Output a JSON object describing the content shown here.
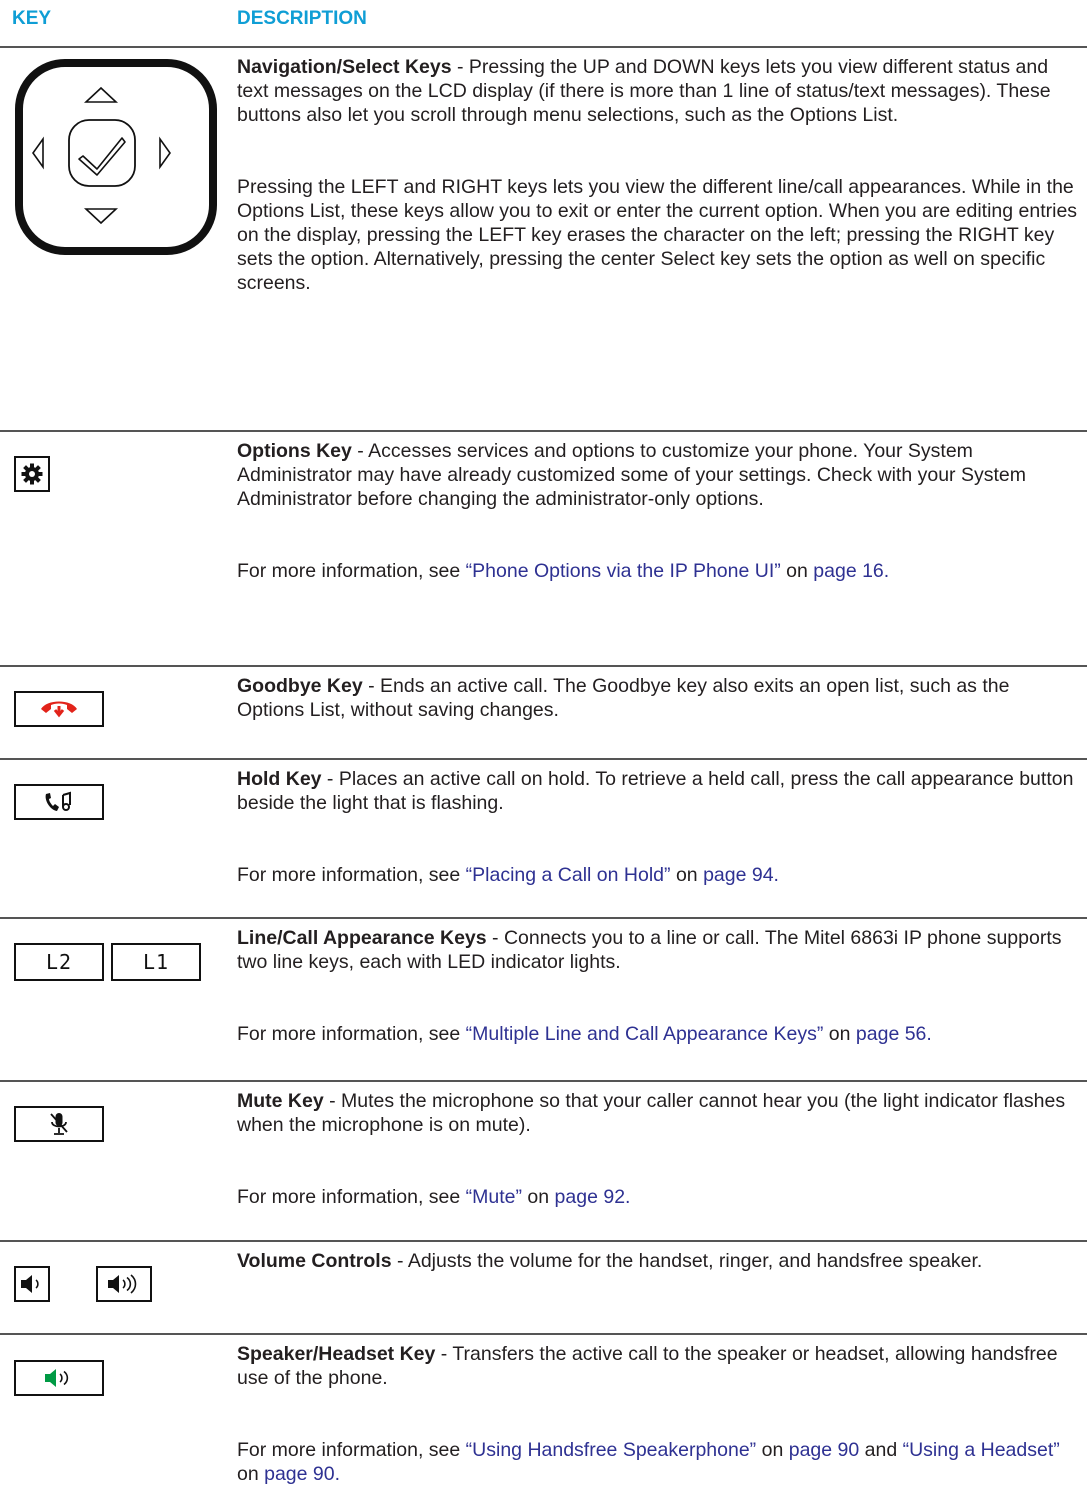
{
  "header": {
    "key": "KEY",
    "description": "DESCRIPTION"
  },
  "rows": [
    {
      "title": "Navigation/Select Keys",
      "icon": "navigation-pad-icon",
      "paras": [
        " - Pressing the UP and DOWN keys lets you view different status and text messages on the LCD display (if there is more than 1 line of status/text messages). These buttons also let you scroll through menu selections, such as the Options List.",
        "Pressing the LEFT and RIGHT keys lets you view the different line/call appearances. While in the Options List, these keys allow you to exit or enter the current option. When you are editing entries on the display, pressing the LEFT key erases the character on the left; pressing the RIGHT key sets the option. Alternatively, pressing the center Select key sets the option as well on specific screens."
      ]
    },
    {
      "title": "Options Key",
      "icon": "gear-icon",
      "text": " - Accesses services and options to customize your phone. Your System Administrator may have already customized some of your settings. Check with your System Administrator before changing the administrator-only options.",
      "more_prefix": "For more information, see ",
      "link": "“Phone Options via the IP Phone UI”",
      "on": " on ",
      "page_link": "page 16."
    },
    {
      "title": "Goodbye Key",
      "icon": "hang-up-icon",
      "text": " - Ends an active call. The Goodbye key also exits an open list, such as the Options List, without saving changes."
    },
    {
      "title": "Hold Key",
      "icon": "hold-icon",
      "text": " - Places an active call on hold. To retrieve a held call, press the call appearance button beside the light that is flashing.",
      "more_prefix": "For more information, see ",
      "link": "“Placing a Call on Hold”",
      "on": " on ",
      "page_link": "page 94."
    },
    {
      "title": "Line/Call Appearance Keys",
      "icon": "line-keys-icon",
      "key_labels": [
        "L2",
        "L1"
      ],
      "text": " - Connects you to a line or call. The Mitel 6863i IP phone supports two line keys, each with LED indicator lights.",
      "more_prefix": "For more information, see ",
      "link": "“Multiple Line and Call Appearance Keys”",
      "on": " on ",
      "page_link": "page 56."
    },
    {
      "title": "Mute Key",
      "icon": "mute-microphone-icon",
      "text": " - Mutes the microphone so that your caller cannot hear you (the light indicator flashes when the microphone is on mute).",
      "more_prefix": "For more information, see ",
      "link": "“Mute”",
      "on": " on ",
      "page_link": "page 92."
    },
    {
      "title": "Volume Controls",
      "icon": "volume-icon",
      "text": " - Adjusts the volume for the handset, ringer, and handsfree speaker."
    },
    {
      "title": "Speaker/Headset Key",
      "icon": "speaker-icon",
      "text": " - Transfers the active call to the speaker or headset, allowing handsfree use of the phone.",
      "more_prefix": "For more information, see ",
      "link": "“Using Handsfree Speakerphone”",
      "on": " on ",
      "page_link": "page 90",
      "and": " and ",
      "link2": "“Using a Headset”",
      "on2": " on ",
      "page_link2": "page 90."
    }
  ],
  "colors": {
    "header": "#0f9ed5",
    "link": "#2e3192",
    "goodbye": "#e2231a",
    "speaker": "#009a44"
  }
}
